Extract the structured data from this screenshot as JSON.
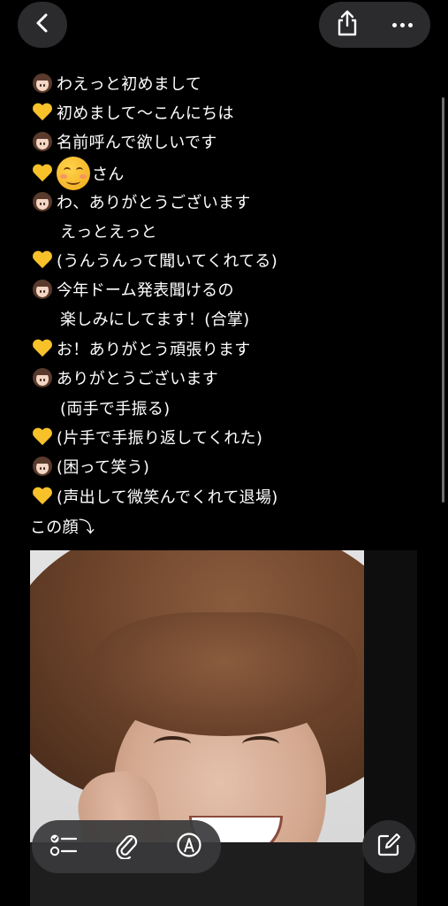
{
  "icons": {
    "back": "chevron-left-icon",
    "share": "share-icon",
    "more": "ellipsis-icon",
    "checklist": "checklist-icon",
    "attach": "paperclip-icon",
    "markup": "markup-pen-icon",
    "compose": "compose-icon",
    "girl": "girl-emoji-icon",
    "heart": "yellow-heart-emoji-icon",
    "smile": "smiling-face-emoji-icon"
  },
  "colors": {
    "background": "#000000",
    "button_bg": "#2d2d30",
    "heart": "#f8c12a"
  },
  "note": {
    "lines": [
      {
        "speaker": "girl",
        "text": "わえっと初めまして"
      },
      {
        "speaker": "heart",
        "text": "初めまして〜こんにちは"
      },
      {
        "speaker": "girl",
        "text": "名前呼んで欲しいです"
      },
      {
        "speaker": "heart",
        "text": "さん",
        "inline_emoji": "smile"
      },
      {
        "speaker": "girl",
        "text": "わ、ありがとうございます"
      },
      {
        "speaker": "none",
        "text": "えっとえっと"
      },
      {
        "speaker": "heart",
        "text": "(うんうんって聞いてくれてる)"
      },
      {
        "speaker": "girl",
        "text": "今年ドーム発表聞けるの"
      },
      {
        "speaker": "none",
        "text": "楽しみにしてます！(合掌)"
      },
      {
        "speaker": "heart",
        "text": "お！ありがとう頑張ります"
      },
      {
        "speaker": "girl",
        "text": "ありがとうございます"
      },
      {
        "speaker": "none",
        "text": "(両手で手振る)"
      },
      {
        "speaker": "heart",
        "text": "(片手で手振り返してくれた)"
      },
      {
        "speaker": "girl",
        "text": "(困って笑う)"
      },
      {
        "speaker": "heart",
        "text": "(声出して微笑んでくれて退場)"
      }
    ],
    "footer": "この顔⤵︎"
  }
}
